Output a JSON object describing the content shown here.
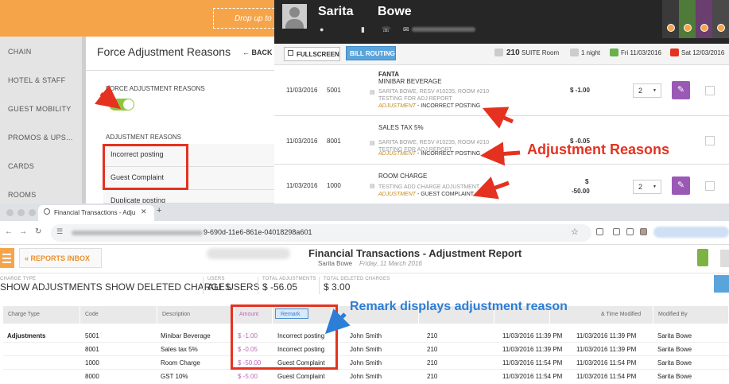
{
  "settings": {
    "drop_hint": "Drop up to 8",
    "side_items": [
      "CHAIN",
      "HOTEL & STAFF",
      "GUEST MOBILITY",
      "PROMOS & UPS...",
      "CARDS",
      "ROOMS"
    ],
    "title": "Force Adjustment Reasons",
    "back_label": "BACK",
    "back_icon": "arrow-left-icon",
    "force_label": "FORCE ADJUSTMENT REASONS",
    "toggle_on": true,
    "reasons_label": "ADJUSTMENT REASONS",
    "reasons": [
      "Incorrect posting",
      "Guest Complaint",
      "Duplicate posting"
    ]
  },
  "bill": {
    "guest_first": "Sarita",
    "guest_last": "Bowe",
    "fullscreen_label": "FULLSCREEN",
    "bill_routing_label": "BILL ROUTING",
    "room_number": "210",
    "room_type": "SUITE Room",
    "nights": "1 night",
    "arrival": "Fri 11/03/2016",
    "departure": "Sat 12/03/2016",
    "rows": [
      {
        "date": "11/03/2016",
        "code": "5001",
        "title": "FANTA",
        "subtitle": "MINIBAR BEVERAGE",
        "desc": "SARITA BOWE, RESV #10235, ROOM #210 TESTING FOR ADJ REPORT",
        "adj_word": "ADJUSTMENT",
        "reason": "INCORRECT POSTING",
        "amount": "$ -1.00",
        "qty": "2"
      },
      {
        "date": "11/03/2016",
        "code": "8001",
        "title": "SALES TAX 5%",
        "subtitle": "",
        "desc": "SARITA BOWE, RESV #10235, ROOM #210 TESTING FOR ADJ REPORT",
        "adj_word": "ADJUSTMENT",
        "reason": "INCORRECT POSTING",
        "amount": "$ -0.05",
        "qty": "2"
      },
      {
        "date": "11/03/2016",
        "code": "1000",
        "title": "ROOM CHARGE",
        "subtitle": "",
        "desc": "TESTING ADD CHARGE ADJUSTMENT",
        "adj_word": "ADJUSTMENT",
        "reason": "GUEST COMPLAINT",
        "amount_top": "$",
        "amount": "-50.00",
        "qty": "2"
      }
    ],
    "annotation": "Adjustment Reasons"
  },
  "browser": {
    "tab_title": "Financial Transactions - Adju",
    "url_suffix": "9-690d-11e6-861e-04018298a601"
  },
  "report": {
    "inbox_label": "REPORTS INBOX",
    "title": "Financial Transactions - Adjustment Report",
    "user": "Sarita Bowe",
    "date": "Friday, 11 March 2016",
    "filters": [
      {
        "label": "CHARGE TYPE",
        "value": "SHOW ADJUSTMENTS SHOW DELETED CHARGES"
      },
      {
        "label": "USERS",
        "value": "ALL USERS"
      },
      {
        "label": "TOTAL ADJUSTMENTS",
        "value": "$ -56.05"
      },
      {
        "label": "TOTAL DELETED CHARGES",
        "value": "$ 3.00"
      }
    ],
    "columns": [
      "Charge Type",
      "Code",
      "Description",
      "Amount",
      "Remark",
      "",
      "",
      "& Time Modified",
      "Modified By"
    ],
    "group_label": "Adjustments",
    "rows": [
      {
        "code": "5001",
        "desc": "Minibar Beverage",
        "amount": "$ -1.00",
        "remark": "Incorrect posting",
        "user": "John Smith",
        "room": "210",
        "created": "11/03/2016 11:39 PM",
        "modified": "11/03/2016 11:39 PM",
        "by": "Sarita Bowe"
      },
      {
        "code": "8001",
        "desc": "Sales tax 5%",
        "amount": "$ -0.05",
        "remark": "Incorrect posting",
        "user": "John Smith",
        "room": "210",
        "created": "11/03/2016 11:39 PM",
        "modified": "11/03/2016 11:39 PM",
        "by": "Sarita Bowe"
      },
      {
        "code": "1000",
        "desc": "Room Charge",
        "amount": "$ -50.00",
        "remark": "Guest Complaint",
        "user": "John Smith",
        "room": "210",
        "created": "11/03/2016 11:54 PM",
        "modified": "11/03/2016 11:54 PM",
        "by": "Sarita Bowe"
      },
      {
        "code": "8000",
        "desc": "GST 10%",
        "amount": "$ -5.00",
        "remark": "Guest Complaint",
        "user": "John Smith",
        "room": "210",
        "created": "11/03/2016 11:54 PM",
        "modified": "11/03/2016 11:54 PM",
        "by": "Sarita Bowe"
      }
    ],
    "annotation": "Remark displays adjustment reason"
  },
  "colors": {
    "accent_orange": "#f6a44a",
    "annotation_red": "#e53220",
    "annotation_blue": "#2c7ed6",
    "toggle_green": "#8dc63f",
    "edit_purple": "#9b59b6"
  }
}
